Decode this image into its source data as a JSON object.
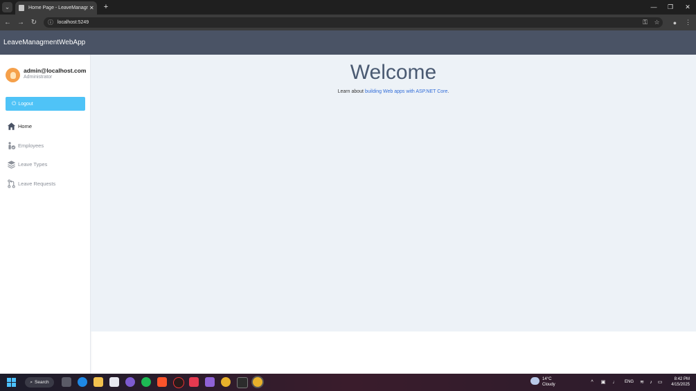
{
  "browser": {
    "tab_title": "Home Page - LeaveManagmentWebApp",
    "tab_close": "✕",
    "new_tab": "+",
    "url": "localhost:5249",
    "window_minimize": "—",
    "window_restore": "❐",
    "window_close": "✕"
  },
  "navbar": {
    "brand": "LeaveManagmentWebApp"
  },
  "sidebar": {
    "user_name": "admin@localhost.com",
    "user_role": "Administrator",
    "logout_label": "Logout",
    "items": [
      {
        "label": "Home",
        "icon": "home-icon",
        "active": true
      },
      {
        "label": "Employees",
        "icon": "employees-icon"
      },
      {
        "label": "Leave Types",
        "icon": "layers-icon"
      },
      {
        "label": "Leave Requests",
        "icon": "pull-request-icon"
      }
    ]
  },
  "main": {
    "heading": "Welcome",
    "learn_prefix": "Learn about ",
    "learn_link": "building Web apps with ASP.NET Core",
    "learn_suffix": "."
  },
  "taskbar": {
    "search_label": "Search",
    "weather_temp": "14°C",
    "weather_condition": "Cloudy",
    "language": "ENG",
    "time": "8:42 PM",
    "date": "4/15/2025"
  },
  "colors": {
    "navbar": "#4a5365",
    "content_bg": "#edf2f7",
    "logout_button": "#4fc3f7",
    "link": "#2f6bd8",
    "heading": "#4a5a72"
  }
}
